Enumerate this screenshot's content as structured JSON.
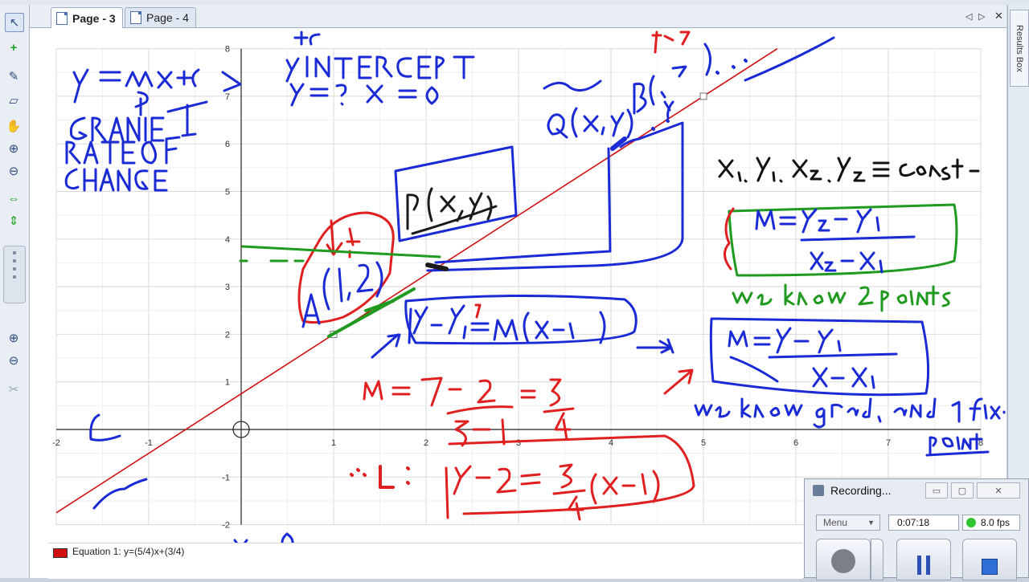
{
  "tabs": [
    {
      "label": "Page - 3",
      "active": true
    },
    {
      "label": "Page - 4",
      "active": false
    }
  ],
  "nav": {
    "prev": "◁",
    "next": "▷",
    "close": "✕"
  },
  "results_box": {
    "label": "Results Box"
  },
  "tools": [
    "select-tool-icon",
    "add-point-icon",
    "pen-icon",
    "eraser-icon",
    "pan-hand-icon",
    "zoom-in-icon",
    "zoom-out-icon",
    "fit-width-icon",
    "fit-height-icon"
  ],
  "chart_data": {
    "type": "line",
    "xlim": [
      -2,
      8
    ],
    "ylim": [
      -2,
      8
    ],
    "x_ticks": [
      -2,
      -1,
      1,
      2,
      3,
      4,
      5,
      6,
      7,
      8
    ],
    "y_ticks": [
      -2,
      -1,
      1,
      2,
      3,
      4,
      5,
      6,
      7,
      8
    ],
    "grid": true,
    "series": [
      {
        "name": "Equation 1: y=(5/4)x+(3/4)",
        "color": "#d01010",
        "slope": 1.25,
        "intercept": 0.75,
        "x": [
          -2,
          5.8
        ]
      }
    ],
    "points": [
      {
        "x": 1,
        "y": 2
      },
      {
        "x": 5,
        "y": 7
      }
    ]
  },
  "legend": {
    "label": "Equation 1: y=(5/4)x+(3/4)",
    "color": "#d01010"
  },
  "recording": {
    "title": "Recording...",
    "menu": "Menu",
    "time": "0:07:18",
    "fps": "8.0 fps",
    "min": "▭",
    "max": "▢",
    "close": "✕"
  }
}
